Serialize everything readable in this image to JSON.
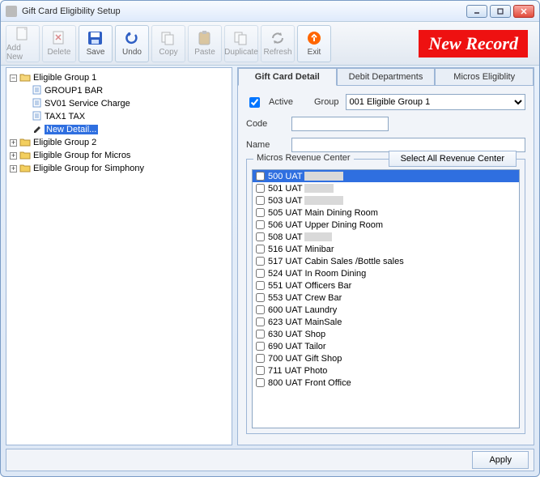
{
  "window": {
    "title": "Gift Card Eligibility Setup"
  },
  "new_record_label": "New Record",
  "toolbar": [
    {
      "id": "add-new",
      "label": "Add New",
      "enabled": false
    },
    {
      "id": "delete",
      "label": "Delete",
      "enabled": false
    },
    {
      "id": "save",
      "label": "Save",
      "enabled": true
    },
    {
      "id": "undo",
      "label": "Undo",
      "enabled": true
    },
    {
      "id": "copy",
      "label": "Copy",
      "enabled": false
    },
    {
      "id": "paste",
      "label": "Paste",
      "enabled": false
    },
    {
      "id": "duplicate",
      "label": "Duplicate",
      "enabled": false
    },
    {
      "id": "refresh",
      "label": "Refresh",
      "enabled": false
    },
    {
      "id": "exit",
      "label": "Exit",
      "enabled": true
    }
  ],
  "tree": {
    "g1": {
      "label": "Eligible Group 1",
      "expanded": true,
      "children": [
        {
          "label": "GROUP1 BAR"
        },
        {
          "label": "SV01 Service Charge"
        },
        {
          "label": "TAX1 TAX"
        },
        {
          "label": "New Detail...",
          "selected": true,
          "edit": true
        }
      ]
    },
    "g2": {
      "label": "Eligible Group 2",
      "expanded": false
    },
    "g3": {
      "label": "Eligible Group for Micros",
      "expanded": false
    },
    "g4": {
      "label": "Eligible Group for Simphony",
      "expanded": false
    }
  },
  "tabs": [
    {
      "id": "detail",
      "label": "Gift Card Detail",
      "active": true
    },
    {
      "id": "debit",
      "label": "Debit Departments",
      "active": false
    },
    {
      "id": "micros",
      "label": "Micros Eligiblity",
      "active": false
    }
  ],
  "form": {
    "active_label": "Active",
    "active_checked": true,
    "group_label": "Group",
    "group_value": "001    Eligible Group 1",
    "code_label": "Code",
    "code_value": "",
    "name_label": "Name",
    "name_value": ""
  },
  "rc": {
    "legend": "Micros Revenue Center",
    "select_all_label": "Select All Revenue Center",
    "items": [
      {
        "label": "500 UAT",
        "selected": true,
        "redacted": true
      },
      {
        "label": "501 UAT",
        "redacted": true
      },
      {
        "label": "503 UAT",
        "redacted": true
      },
      {
        "label": "505 UAT Main Dining Room"
      },
      {
        "label": "506 UAT Upper Dining Room"
      },
      {
        "label": "508 UAT",
        "redacted": true
      },
      {
        "label": "516 UAT Minibar"
      },
      {
        "label": "517 UAT Cabin Sales /Bottle sales"
      },
      {
        "label": "524 UAT In Room Dining"
      },
      {
        "label": "551 UAT Officers Bar"
      },
      {
        "label": "553 UAT Crew Bar"
      },
      {
        "label": "600 UAT Laundry"
      },
      {
        "label": "623 UAT MainSale"
      },
      {
        "label": "630 UAT Shop"
      },
      {
        "label": "690 UAT Tailor"
      },
      {
        "label": "700 UAT Gift Shop"
      },
      {
        "label": "711 UAT Photo"
      },
      {
        "label": "800 UAT Front Office"
      }
    ]
  },
  "footer": {
    "apply_label": "Apply"
  }
}
